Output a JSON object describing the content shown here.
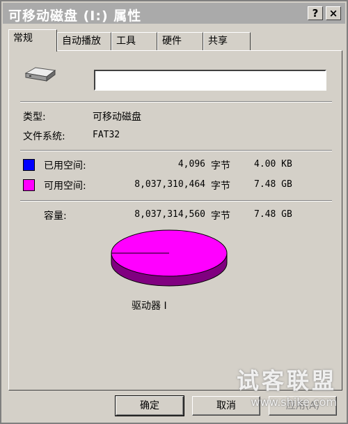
{
  "window": {
    "title": "可移动磁盘 (I:) 属性"
  },
  "titlebar_buttons": {
    "help": "?",
    "close": "×"
  },
  "tabs": [
    {
      "label": "常规",
      "active": true
    },
    {
      "label": "自动播放",
      "active": false
    },
    {
      "label": "工具",
      "active": false
    },
    {
      "label": "硬件",
      "active": false
    },
    {
      "label": "共享",
      "active": false
    }
  ],
  "general": {
    "drive_name_value": "",
    "type_label": "类型:",
    "type_value": "可移动磁盘",
    "fs_label": "文件系统:",
    "fs_value": "FAT32",
    "used": {
      "label": "已用空间:",
      "bytes": "4,096",
      "unit": "字节",
      "size": "4.00 KB",
      "color": "#0000ff"
    },
    "free": {
      "label": "可用空间:",
      "bytes": "8,037,310,464",
      "unit": "字节",
      "size": "7.48 GB",
      "color": "#ff00ff"
    },
    "capacity": {
      "label": "容量:",
      "bytes": "8,037,314,560",
      "unit": "字节",
      "size": "7.48 GB"
    },
    "drive_label": "驱动器 I",
    "used_fraction": 5e-07
  },
  "buttons": {
    "ok": "确定",
    "cancel": "取消",
    "apply": "应用(A)"
  },
  "watermark": {
    "line1": "试客联盟",
    "line2": "www.shike.com"
  },
  "colors": {
    "face": "#d4d0c8",
    "title_inactive": "#aaaaaa",
    "free_dark": "#800080"
  }
}
